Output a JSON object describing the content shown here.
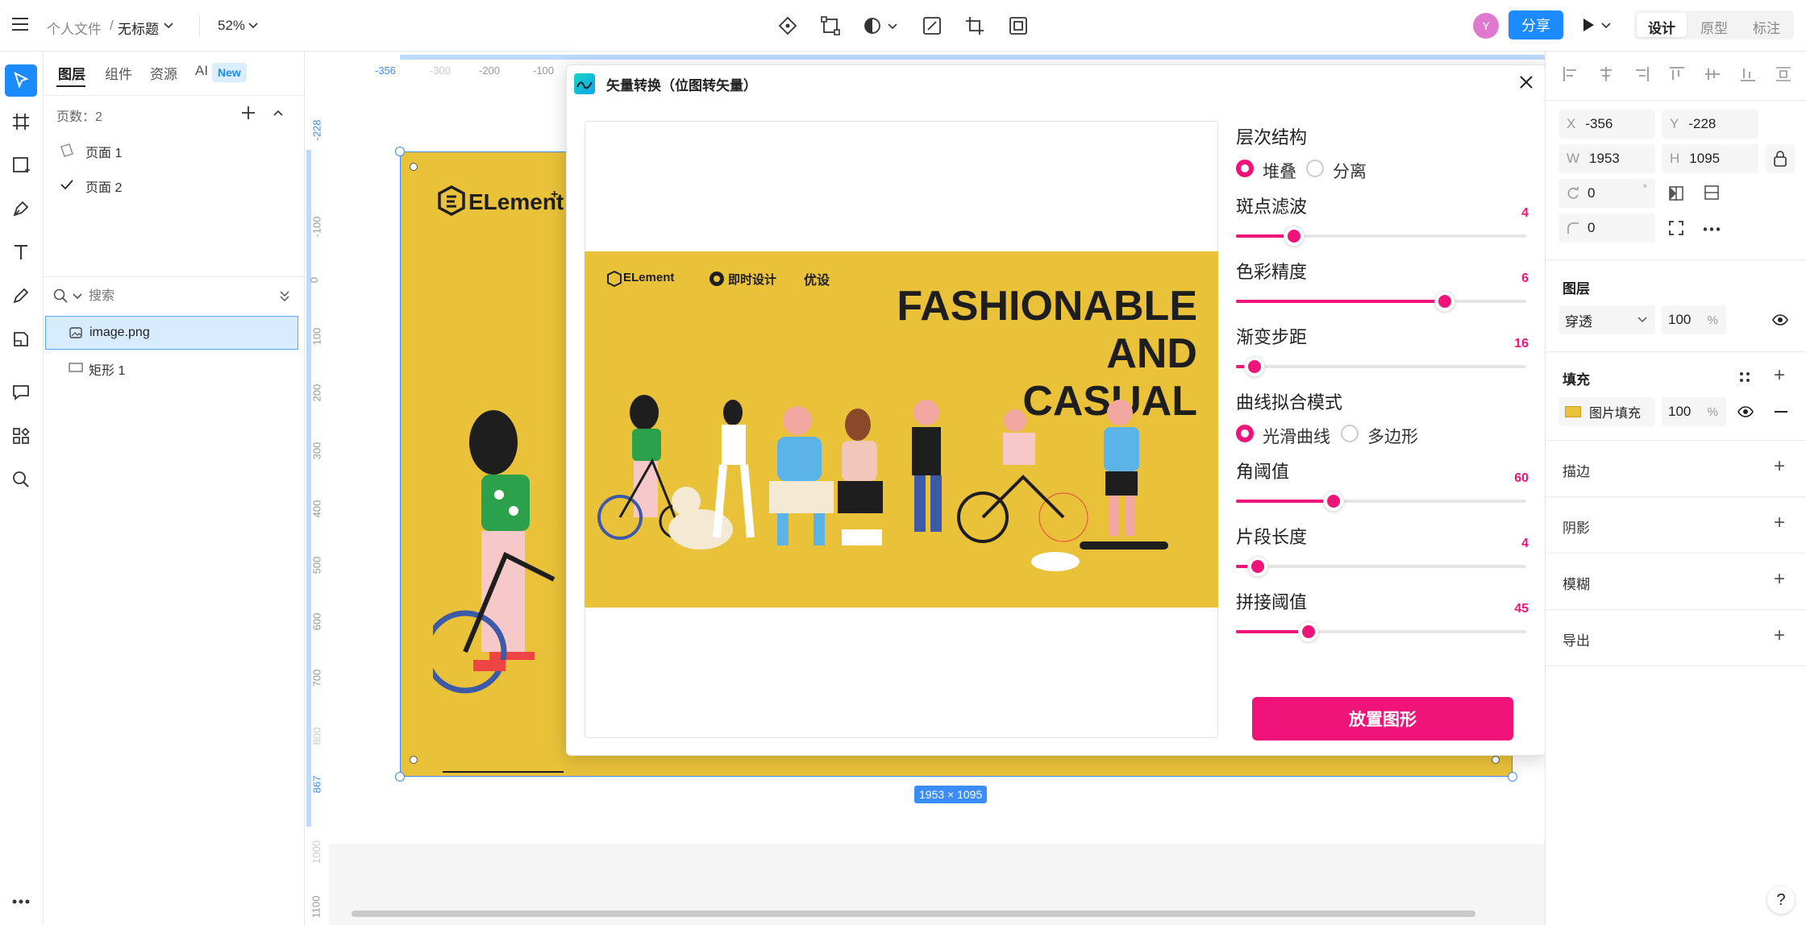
{
  "header": {
    "breadcrumb_root": "个人文件",
    "breadcrumb_sep": "/",
    "doc_title": "无标题",
    "zoom": "52%",
    "avatar_letter": "Y",
    "share_label": "分享",
    "modes": [
      "设计",
      "原型",
      "标注"
    ],
    "active_mode": "设计"
  },
  "left_panel": {
    "tabs": [
      "图层",
      "组件",
      "资源",
      "AI"
    ],
    "new_badge": "New",
    "page_count": "页数：2",
    "pages": [
      {
        "label": "页面 1",
        "current": false
      },
      {
        "label": "页面 2",
        "current": true
      }
    ],
    "search_placeholder": "搜索",
    "layers": [
      {
        "label": "image.png",
        "type": "image",
        "selected": true
      },
      {
        "label": "矩形 1",
        "type": "rect",
        "selected": false
      }
    ]
  },
  "canvas": {
    "ruler_top": [
      "-356",
      "-300",
      "-200",
      "-100"
    ],
    "ruler_left": [
      "-228",
      "-100",
      "0",
      "100",
      "200",
      "300",
      "400",
      "500",
      "600",
      "700",
      "800",
      "867",
      "1000",
      "1100"
    ],
    "size_label": "1953 × 1095",
    "artboard_brand": "ELement",
    "brand_sup": "+"
  },
  "dialog": {
    "title": "矢量转换（位图转矢量）",
    "preview": {
      "logos": [
        "ELement",
        "即时设计",
        "优设"
      ],
      "headline": [
        "FASHIONABLE",
        "AND",
        "CASUAL"
      ],
      "bg_color": "#e9c23a"
    },
    "hierarchy_label": "层次结构",
    "hierarchy_options": [
      "堆叠",
      "分离"
    ],
    "hierarchy_selected": "堆叠",
    "sliders": [
      {
        "label": "斑点滤波",
        "value": "4",
        "fraction": 0.2
      },
      {
        "label": "色彩精度",
        "value": "6",
        "fraction": 0.72
      },
      {
        "label": "渐变步距",
        "value": "16",
        "fraction": 0.065
      }
    ],
    "curve_label": "曲线拟合模式",
    "curve_options": [
      "光滑曲线",
      "多边形"
    ],
    "curve_selected": "光滑曲线",
    "sliders2": [
      {
        "label": "角阈值",
        "value": "60",
        "fraction": 0.335
      },
      {
        "label": "片段长度",
        "value": "4",
        "fraction": 0.075
      },
      {
        "label": "拼接阈值",
        "value": "45",
        "fraction": 0.25
      }
    ],
    "place_button": "放置图形",
    "accent": "#f0137a"
  },
  "right_panel": {
    "x_label": "X",
    "x_value": "-356",
    "y_label": "Y",
    "y_value": "-228",
    "w_label": "W",
    "w_value": "1953",
    "h_label": "H",
    "h_value": "1095",
    "rotation": "0",
    "rotation_unit": "°",
    "radius": "0",
    "layer_section": "图层",
    "blend_mode": "穿透",
    "layer_opacity": "100",
    "percent": "%",
    "fill_section": "填充",
    "fill_type": "图片填充",
    "fill_opacity": "100",
    "stroke_section": "描边",
    "shadow_section": "阴影",
    "blur_section": "模糊",
    "export_section": "导出"
  },
  "help": "?"
}
